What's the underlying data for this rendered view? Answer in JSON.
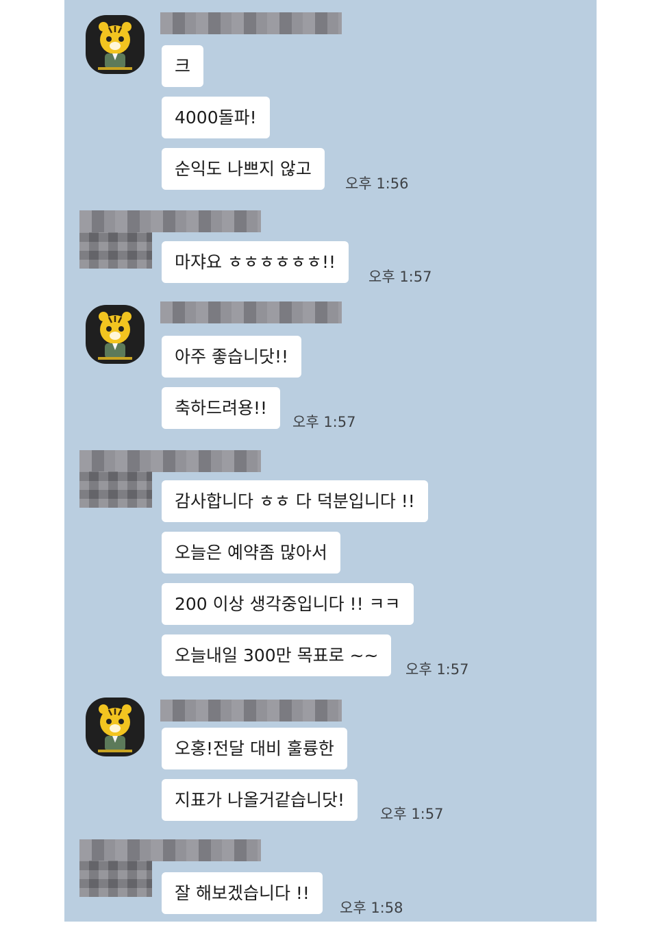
{
  "groups": [
    {
      "sender": "tiger",
      "messages": [
        "크",
        "4000돌파!",
        "순익도 나쁘지 않고"
      ],
      "time": "오후 1:56"
    },
    {
      "sender": "blurred",
      "messages": [
        "마쟈요 ㅎㅎㅎㅎㅎㅎ!!"
      ],
      "time": "오후 1:57"
    },
    {
      "sender": "tiger",
      "messages": [
        "아주 좋습니닷!!",
        "축하드려용!!"
      ],
      "time": "오후 1:57"
    },
    {
      "sender": "blurred",
      "messages": [
        "감사합니다 ㅎㅎ 다 덕분입니다 !!",
        "오늘은 예약좀 많아서",
        "200 이상 생각중입니다 !! ㅋㅋ",
        "오늘내일 300만 목표로 ~~"
      ],
      "time": "오후 1:57"
    },
    {
      "sender": "tiger",
      "messages": [
        "오홍!전달 대비 훌륭한",
        "지표가 나올거같습니닷!"
      ],
      "time": "오후 1:57"
    },
    {
      "sender": "blurred",
      "messages": [
        "잘 해보겠습니다 !!"
      ],
      "time": "오후 1:58"
    }
  ]
}
